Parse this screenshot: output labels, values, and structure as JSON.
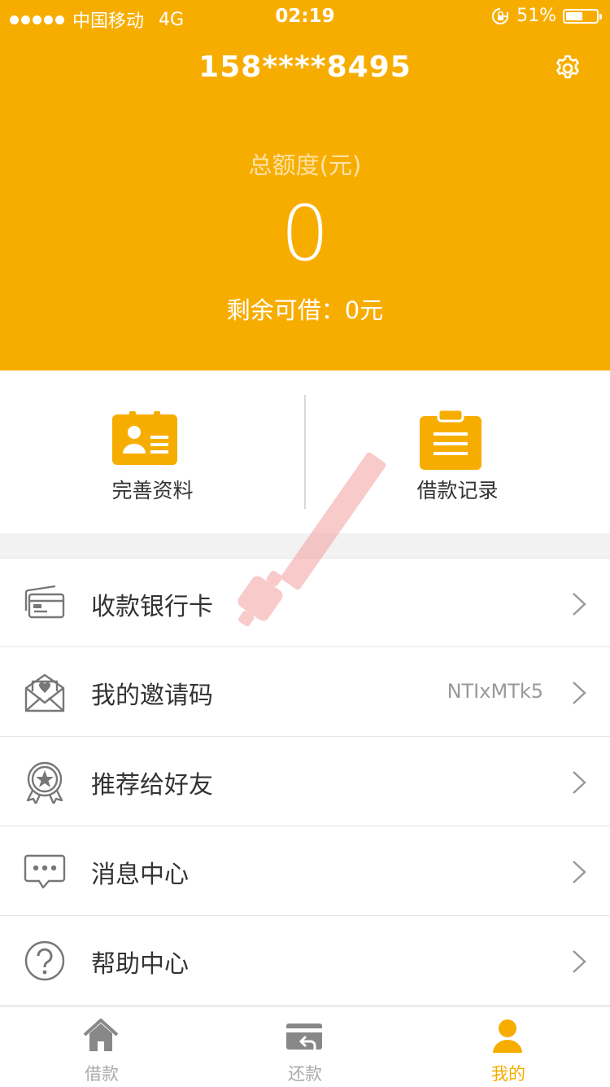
{
  "status_bar": {
    "carrier": "中国移动",
    "network": "4G",
    "time": "02:19",
    "battery": "51%"
  },
  "header": {
    "phone": "158****8495",
    "quota_label": "总额度(元)",
    "quota_value": "0",
    "remaining": "剩余可借：0元"
  },
  "quick_actions": [
    {
      "label": "完善资料",
      "icon": "id-card-icon"
    },
    {
      "label": "借款记录",
      "icon": "clipboard-icon"
    }
  ],
  "menu": [
    {
      "label": "收款银行卡",
      "value": "",
      "icon": "bank-card-icon"
    },
    {
      "label": "我的邀请码",
      "value": "NTIxMTk5",
      "icon": "invite-envelope-icon"
    },
    {
      "label": "推荐给好友",
      "value": "",
      "icon": "star-badge-icon"
    },
    {
      "label": "消息中心",
      "value": "",
      "icon": "chat-bubble-icon"
    },
    {
      "label": "帮助中心",
      "value": "",
      "icon": "help-icon"
    }
  ],
  "tabbar": [
    {
      "label": "借款",
      "icon": "home-icon",
      "active": false
    },
    {
      "label": "还款",
      "icon": "repay-wallet-icon",
      "active": false
    },
    {
      "label": "我的",
      "icon": "user-icon",
      "active": true
    }
  ],
  "colors": {
    "brand": "#f7ad00",
    "text": "#333333",
    "muted": "#999999"
  }
}
